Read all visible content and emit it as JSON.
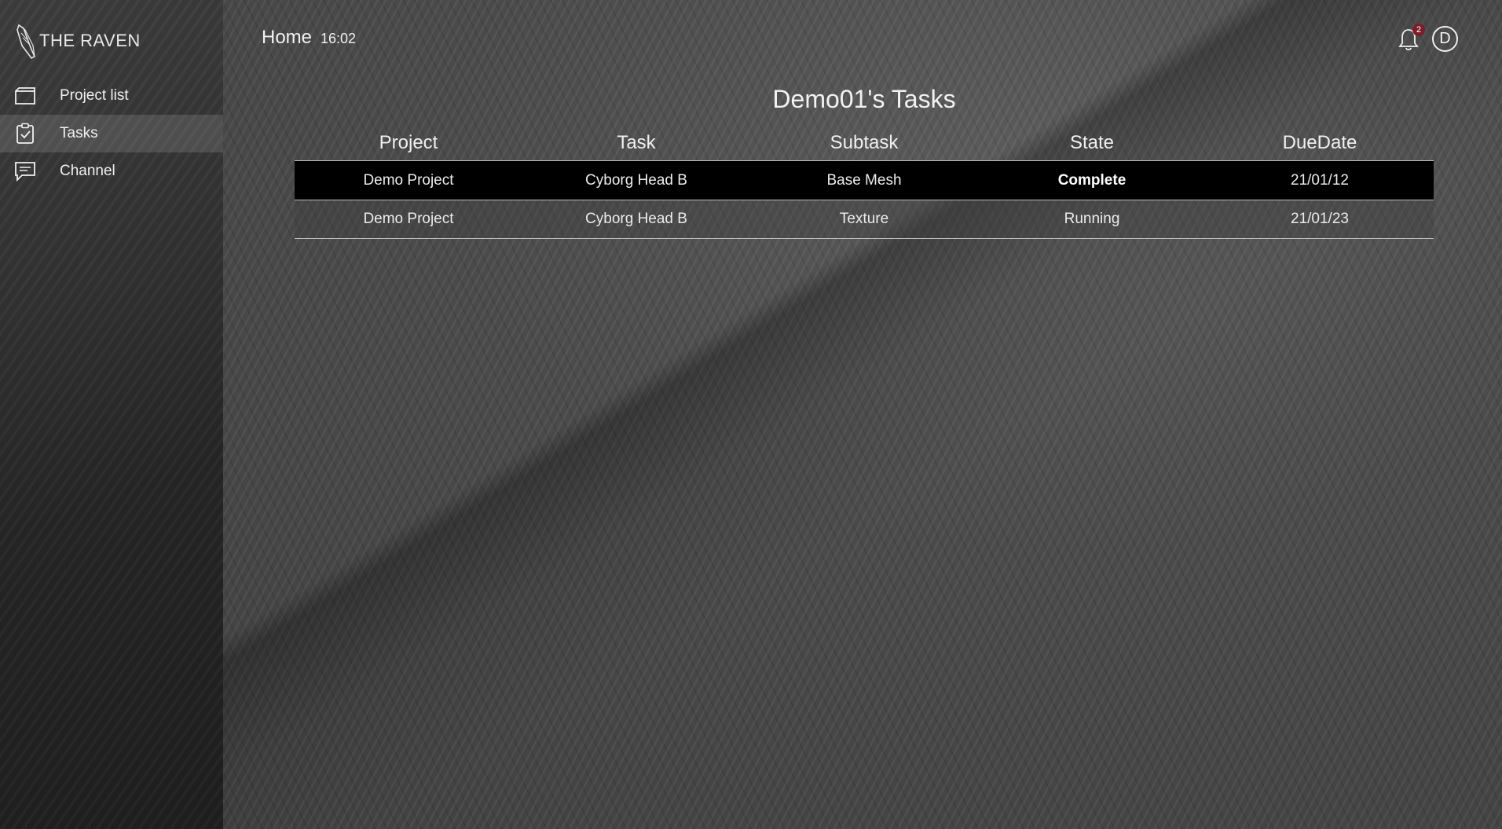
{
  "sidebar": {
    "logo_text": "THE RAVEN",
    "items": [
      {
        "label": "Project list",
        "icon": "folder-icon",
        "active": false
      },
      {
        "label": "Tasks",
        "icon": "clipboard-check-icon",
        "active": true
      },
      {
        "label": "Channel",
        "icon": "chat-icon",
        "active": false
      }
    ]
  },
  "header": {
    "title": "Home",
    "time": "16:02",
    "notification_count": "2",
    "avatar_initial": "D"
  },
  "main": {
    "title": "Demo01's Tasks",
    "columns": [
      "Project",
      "Task",
      "Subtask",
      "State",
      "DueDate"
    ],
    "rows": [
      {
        "project": "Demo Project",
        "task": "Cyborg Head B",
        "subtask": "Base Mesh",
        "state": "Complete",
        "due": "21/01/12"
      },
      {
        "project": "Demo Project",
        "task": "Cyborg Head B",
        "subtask": "Texture",
        "state": "Running",
        "due": "21/01/23"
      }
    ]
  },
  "colors": {
    "selected_row": "#000000",
    "badge": "#7a1f28",
    "sidebar_active": "#4a4a4a"
  }
}
